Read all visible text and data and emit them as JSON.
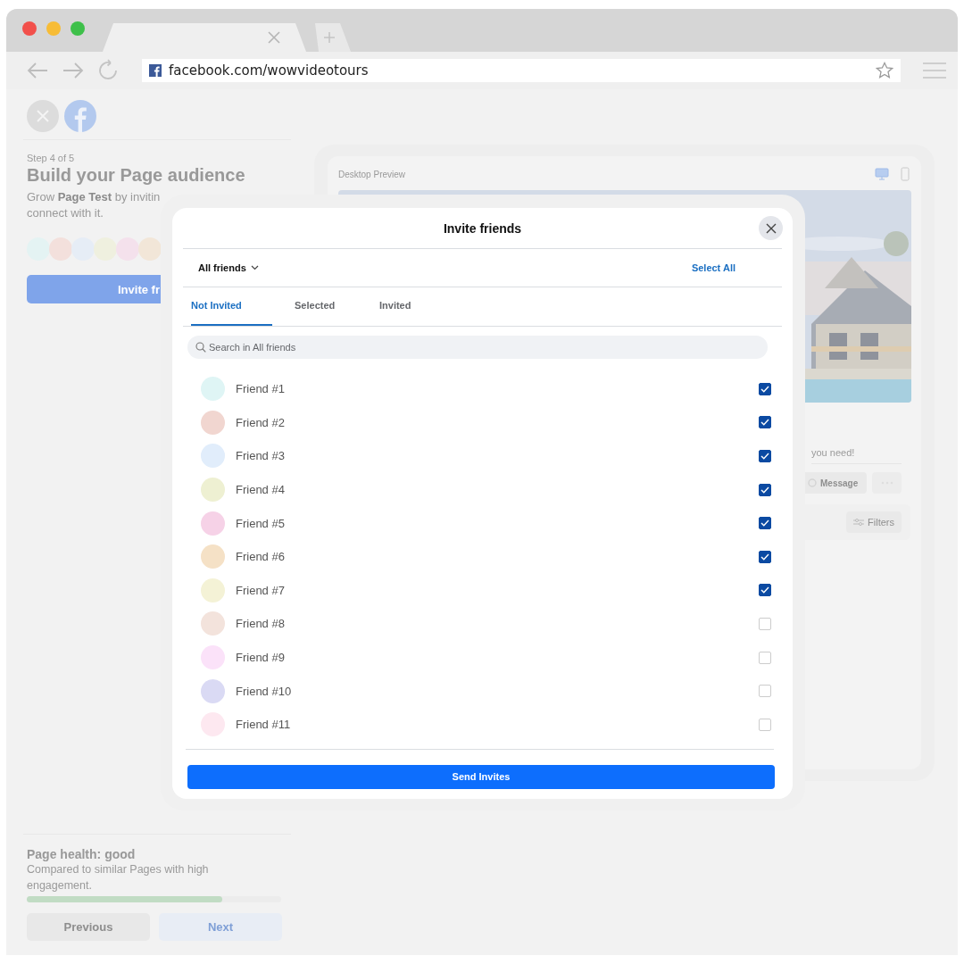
{
  "browser": {
    "url": "facebook.com/wowvideotours"
  },
  "setup": {
    "step": "Step 4 of 5",
    "title": "Build your Page audience",
    "description_lines": [
      "Grow **Page Test** by invitin",
      "connect with it."
    ],
    "avatars": [
      {
        "color": "#e4f3f3"
      },
      {
        "color": "#f3e0dc"
      },
      {
        "color": "#e6edf6"
      },
      {
        "color": "#eff0df"
      },
      {
        "color": "#f4e1ec"
      },
      {
        "color": "#f2e6d8"
      }
    ],
    "invite_button": "Invite fr",
    "health_title": "Page health: good",
    "health_description": "Compared to similar Pages with high engagement.",
    "health": {
      "level": 0.77
    },
    "previous_button": "Previous",
    "next_button": "Next"
  },
  "preview": {
    "title": "Desktop Preview",
    "view_modes": [
      {
        "kind": "desktop",
        "selected": true
      },
      {
        "kind": "phone",
        "selected": false
      }
    ],
    "tagline": "you need!",
    "message_button": "Message",
    "filters_button": "Filters"
  },
  "modal": {
    "title": "Invite friends",
    "filter": "All friends",
    "select_all": "Select All",
    "tabs": [
      {
        "label": "Not Invited",
        "selected": true
      },
      {
        "label": "Selected",
        "selected": false
      },
      {
        "label": "Invited",
        "selected": false
      }
    ],
    "search": {
      "placeholder": "Search in All friends"
    },
    "friends": [
      {
        "name": "Friend #1",
        "color": "#dff5f5",
        "checked": true
      },
      {
        "name": "Friend #2",
        "color": "#f1d6d0",
        "checked": true
      },
      {
        "name": "Friend #3",
        "color": "#e1edfb",
        "checked": true
      },
      {
        "name": "Friend #4",
        "color": "#eef0d2",
        "checked": true
      },
      {
        "name": "Friend #5",
        "color": "#f6d2e7",
        "checked": true
      },
      {
        "name": "Friend #6",
        "color": "#f5e1c6",
        "checked": true
      },
      {
        "name": "Friend #7",
        "color": "#f4f2d6",
        "checked": true
      },
      {
        "name": "Friend #8",
        "color": "#f3e3dc",
        "checked": false
      },
      {
        "name": "Friend #9",
        "color": "#fbe2f9",
        "checked": false
      },
      {
        "name": "Friend #10",
        "color": "#dadaf4",
        "checked": false
      },
      {
        "name": "Friend #11",
        "color": "#fde8f0",
        "checked": false
      }
    ],
    "send_button": "Send Invites"
  }
}
